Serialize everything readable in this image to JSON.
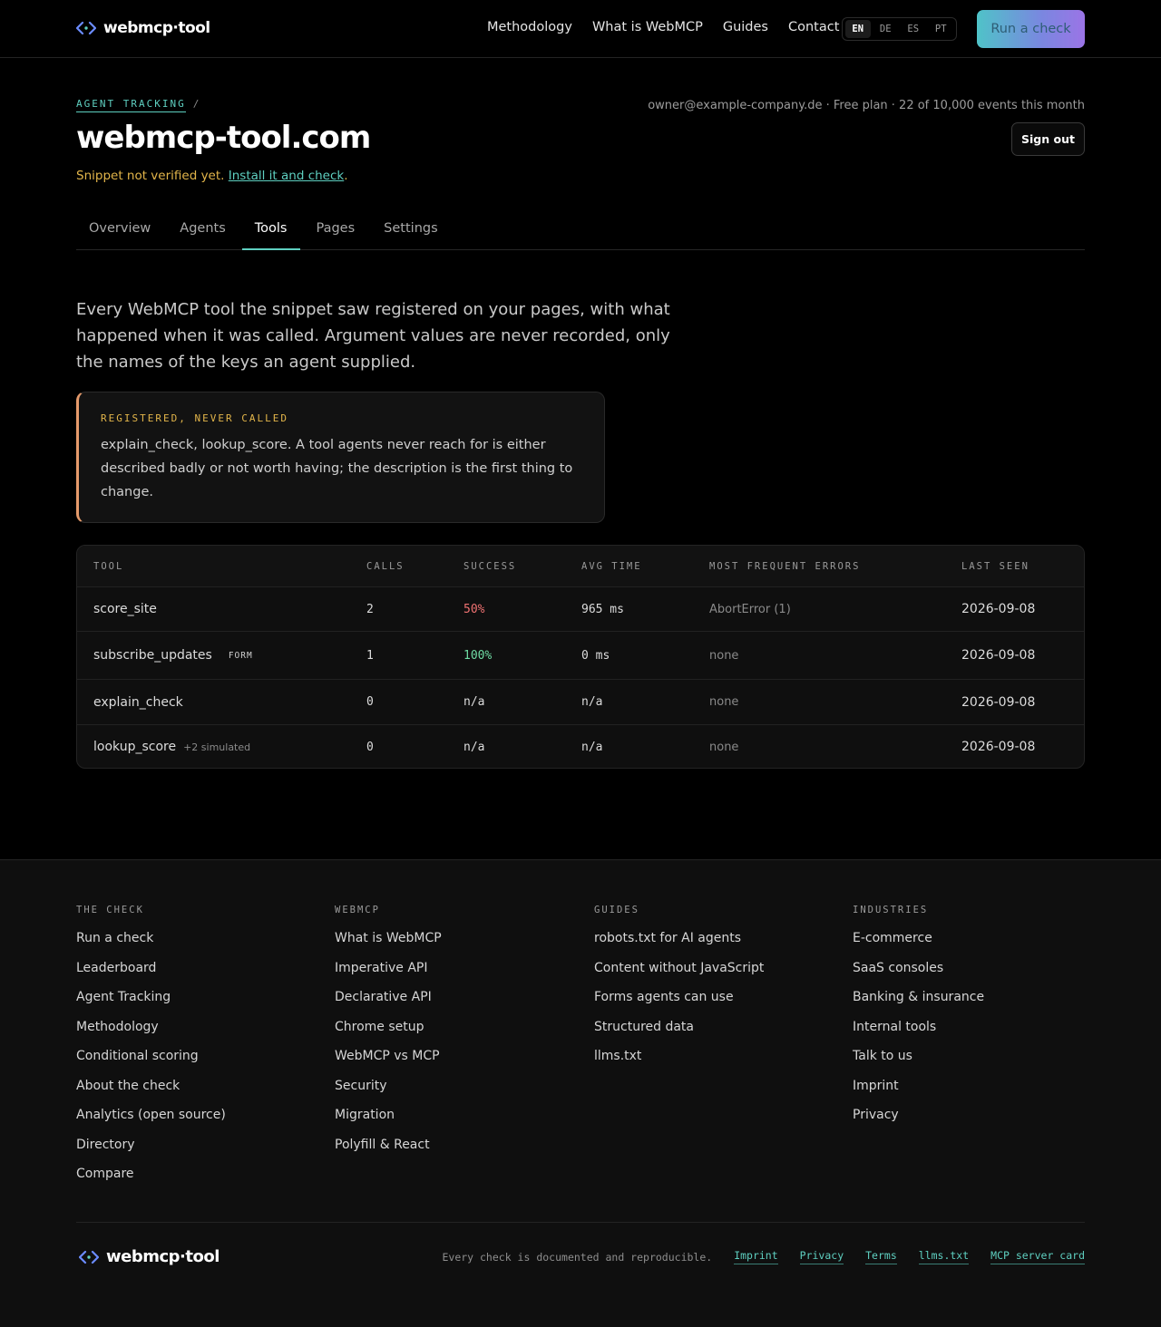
{
  "brand": {
    "name": "webmcp·tool"
  },
  "colors": {
    "accent": "#5ecfc0",
    "warning": "#e2b54a",
    "error": "#f07272",
    "success": "#6fdca4"
  },
  "nav": {
    "items": [
      "Methodology",
      "What is WebMCP",
      "Guides",
      "Contact"
    ]
  },
  "languages": {
    "options": [
      "EN",
      "DE",
      "ES",
      "PT"
    ],
    "active": "EN"
  },
  "header": {
    "cta": "Run a check"
  },
  "breadcrumb": {
    "section": "AGENT TRACKING",
    "separator": "/"
  },
  "site": {
    "domain": "webmcp-tool.com",
    "status_text": "Snippet not verified yet.",
    "status_link": "Install it and check",
    "status_end": "."
  },
  "account": {
    "summary": "owner@example-company.de · Free plan · 22 of 10,000 events this month",
    "signout": "Sign out"
  },
  "tabs": [
    {
      "label": "Overview"
    },
    {
      "label": "Agents"
    },
    {
      "label": "Tools",
      "active": true
    },
    {
      "label": "Pages"
    },
    {
      "label": "Settings"
    }
  ],
  "intro": "Every WebMCP tool the snippet saw registered on your pages, with what happened when it was called. Argument values are never recorded, only the names of the keys an agent supplied.",
  "callout": {
    "label": "REGISTERED, NEVER CALLED",
    "text": "explain_check, lookup_score. A tool agents never reach for is either described badly or not worth having; the description is the first thing to change."
  },
  "table": {
    "columns": [
      "TOOL",
      "CALLS",
      "SUCCESS",
      "AVG TIME",
      "MOST FREQUENT ERRORS",
      "LAST SEEN"
    ],
    "rows": [
      {
        "tool": "score_site",
        "tag": "",
        "note": "",
        "calls": "2",
        "success": "50%",
        "avg": "965 ms",
        "errors": "AbortError (1)",
        "last": "2026-09-08"
      },
      {
        "tool": "subscribe_updates",
        "tag": "FORM",
        "note": "",
        "calls": "1",
        "success": "100%",
        "avg": "0 ms",
        "errors": "none",
        "last": "2026-09-08"
      },
      {
        "tool": "explain_check",
        "tag": "",
        "note": "",
        "calls": "0",
        "success": "n/a",
        "avg": "n/a",
        "errors": "none",
        "last": "2026-09-08"
      },
      {
        "tool": "lookup_score",
        "tag": "",
        "note": "+2 simulated",
        "calls": "0",
        "success": "n/a",
        "avg": "n/a",
        "errors": "none",
        "last": "2026-09-08"
      }
    ]
  },
  "footer": {
    "columns": [
      {
        "heading": "THE CHECK",
        "links": [
          "Run a check",
          "Leaderboard",
          "Agent Tracking",
          "Methodology",
          "Conditional scoring",
          "About the check",
          "Analytics (open source)",
          "Directory",
          "Compare"
        ]
      },
      {
        "heading": "WEBMCP",
        "links": [
          "What is WebMCP",
          "Imperative API",
          "Declarative API",
          "Chrome setup",
          "WebMCP vs MCP",
          "Security",
          "Migration",
          "Polyfill & React"
        ]
      },
      {
        "heading": "GUIDES",
        "links": [
          "robots.txt for AI agents",
          "Content without JavaScript",
          "Forms agents can use",
          "Structured data",
          "llms.txt"
        ]
      },
      {
        "heading": "INDUSTRIES",
        "links": [
          "E-commerce",
          "SaaS consoles",
          "Banking & insurance",
          "Internal tools",
          "Talk to us",
          "Imprint",
          "Privacy"
        ]
      }
    ],
    "note": "Every check is documented and reproducible.",
    "links": [
      "Imprint",
      "Privacy",
      "Terms",
      "llms.txt",
      "MCP server card"
    ]
  }
}
